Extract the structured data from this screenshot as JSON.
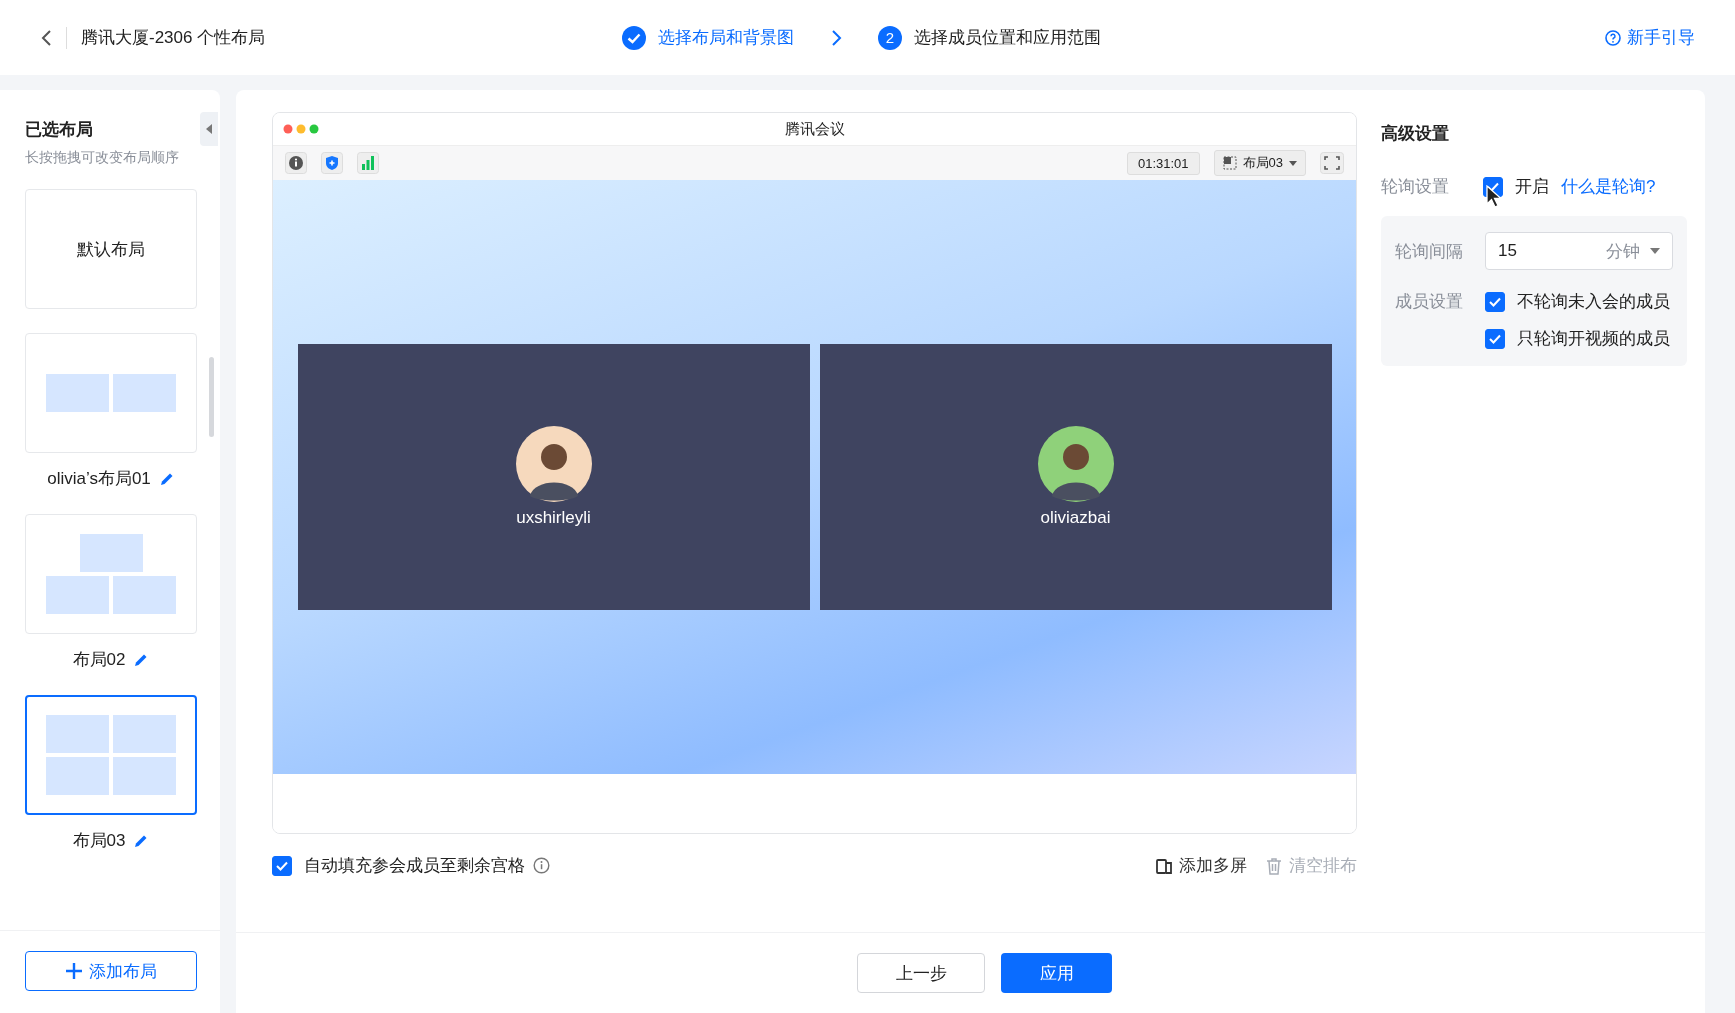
{
  "header": {
    "title": "腾讯大厦-2306 个性布局",
    "steps": [
      {
        "label": "选择布局和背景图",
        "completed": true
      },
      {
        "number": "2",
        "label": "选择成员位置和应用范围",
        "completed": false
      }
    ],
    "help": "新手引导"
  },
  "sidebar": {
    "title": "已选布局",
    "hint": "长按拖拽可改变布局顺序",
    "layouts": [
      {
        "kind": "text",
        "label": "默认布局",
        "selected": false
      },
      {
        "kind": "two",
        "label": "olivia’s布局01",
        "selected": false
      },
      {
        "kind": "pyramid",
        "label": "布局02",
        "selected": false
      },
      {
        "kind": "quad",
        "label": "布局03",
        "selected": true
      }
    ],
    "add_button": "添加布局"
  },
  "preview": {
    "window_title": "腾讯会议",
    "timer": "01:31:01",
    "layout_menu": "布局03",
    "tiles": [
      {
        "name": "uxshirleyli"
      },
      {
        "name": "oliviazbai"
      }
    ]
  },
  "autofill": {
    "label": "自动填充参会成员至剩余宫格",
    "checked": true
  },
  "actions": [
    {
      "kind": "screen",
      "label": "添加多屏",
      "disabled": false
    },
    {
      "kind": "trash",
      "label": "清空排布",
      "disabled": true
    }
  ],
  "settings": {
    "title": "高级设置",
    "polling": {
      "label": "轮询设置",
      "option": "开启",
      "checked": true,
      "link": "什么是轮询?"
    },
    "interval": {
      "label": "轮询间隔",
      "value": "15",
      "unit": "分钟"
    },
    "members": {
      "label": "成员设置",
      "options": [
        {
          "label": "不轮询未入会的成员",
          "checked": true
        },
        {
          "label": "只轮询开视频的成员",
          "checked": true
        }
      ]
    }
  },
  "footer": {
    "buttons": [
      {
        "label": "上一步",
        "kind": "secondary"
      },
      {
        "label": "应用",
        "kind": "primary"
      }
    ]
  }
}
